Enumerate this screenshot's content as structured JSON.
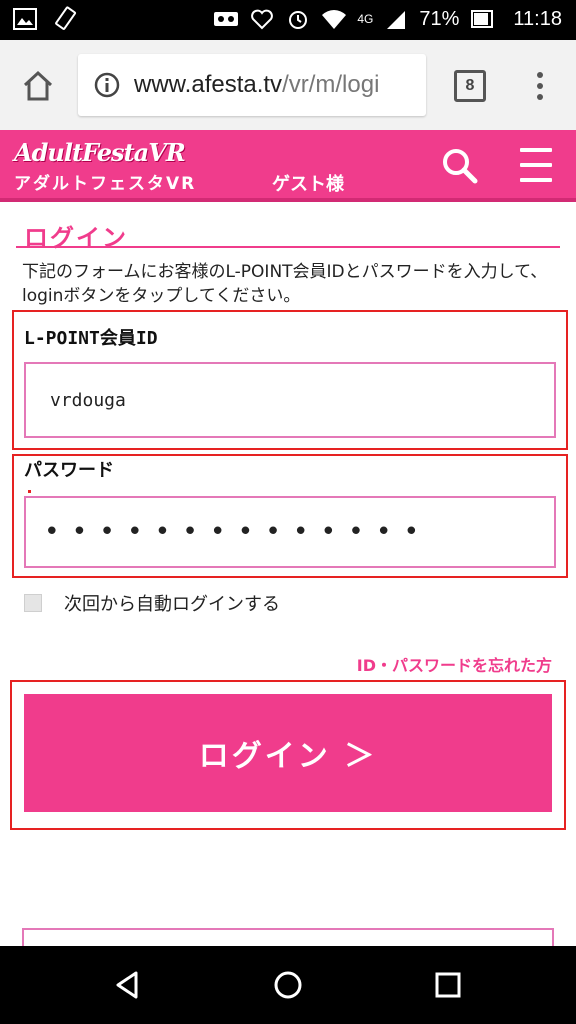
{
  "status_bar": {
    "battery_percent": "71%",
    "time": "11:18",
    "network_label": "4G"
  },
  "browser": {
    "url_host": "www.afesta.tv",
    "url_path": "/vr/m/logi",
    "tab_count": "8"
  },
  "site_header": {
    "logo_text": "AdultFestaVR",
    "logo_subtitle": "アダルトフェスタVR",
    "guest_label": "ゲスト様",
    "brand_color": "#f03c8c"
  },
  "login": {
    "title": "ログイン",
    "instructions": "下記のフォームにお客様のL-POINT会員IDとパスワードを入力して、 loginボタンをタップしてください。",
    "id_label": "L-POINT会員ID",
    "id_value": "vrdouga",
    "password_label": "パスワード",
    "password_value": "••••••••••••••",
    "auto_login_label": "次回から自動ログインする",
    "forgot_link": "ID・パスワードを忘れた方",
    "submit_label": "ログイン ＞"
  }
}
